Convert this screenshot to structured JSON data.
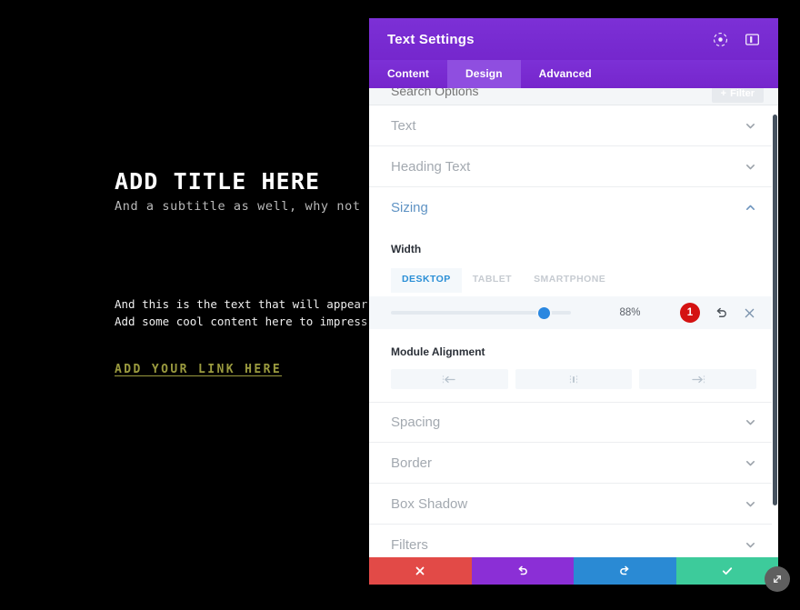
{
  "preview": {
    "title": "ADD TITLE HERE",
    "subtitle": "And a subtitle as well, why not",
    "body_line1": "And this is the text that will appear as a pa",
    "body_line2": "Add some cool content here to impress your v",
    "link": "ADD YOUR LINK HERE",
    "link_color": "#9b9b3f",
    "background": "#000000"
  },
  "panel": {
    "title": "Text Settings",
    "header": {
      "icons": [
        {
          "name": "focus-target-icon"
        },
        {
          "name": "layout-panel-icon"
        }
      ]
    },
    "tabs": [
      {
        "label": "Content",
        "active": false
      },
      {
        "label": "Design",
        "active": true
      },
      {
        "label": "Advanced",
        "active": false
      }
    ],
    "search": {
      "placeholder": "Search Options",
      "value": ""
    },
    "filter_button": {
      "label": "Filter",
      "plus": "+"
    },
    "sections": [
      {
        "label": "Text",
        "open": false
      },
      {
        "label": "Heading Text",
        "open": false
      },
      {
        "label": "Sizing",
        "open": true
      },
      {
        "label": "Spacing",
        "open": false
      },
      {
        "label": "Border",
        "open": false
      },
      {
        "label": "Box Shadow",
        "open": false
      },
      {
        "label": "Filters",
        "open": false
      }
    ],
    "sizing": {
      "width_label": "Width",
      "device_tabs": [
        {
          "label": "DESKTOP",
          "active": true
        },
        {
          "label": "TABLET",
          "active": false
        },
        {
          "label": "SMARTPHONE",
          "active": false
        }
      ],
      "slider": {
        "value": "88%",
        "percent": 85,
        "handle_color": "#2a87e0"
      },
      "badge": {
        "count": "1",
        "color": "#d41212"
      },
      "reset_icon": "undo-arrow-icon",
      "clear_icon": "close-x-icon",
      "alignment_label": "Module Alignment",
      "alignment_buttons": [
        {
          "name": "align-left-icon"
        },
        {
          "name": "align-center-icon"
        },
        {
          "name": "align-right-icon"
        }
      ]
    },
    "actions": [
      {
        "name": "cancel-button",
        "icon": "close-x-icon",
        "color": "#e24a47"
      },
      {
        "name": "undo-button",
        "icon": "undo-arrow-icon",
        "color": "#8b2fd6"
      },
      {
        "name": "redo-button",
        "icon": "redo-arrow-icon",
        "color": "#2a8ad4"
      },
      {
        "name": "save-button",
        "icon": "checkmark-icon",
        "color": "#3dcb9b"
      }
    ],
    "resize_handle_icon": "diagonal-resize-icon"
  }
}
